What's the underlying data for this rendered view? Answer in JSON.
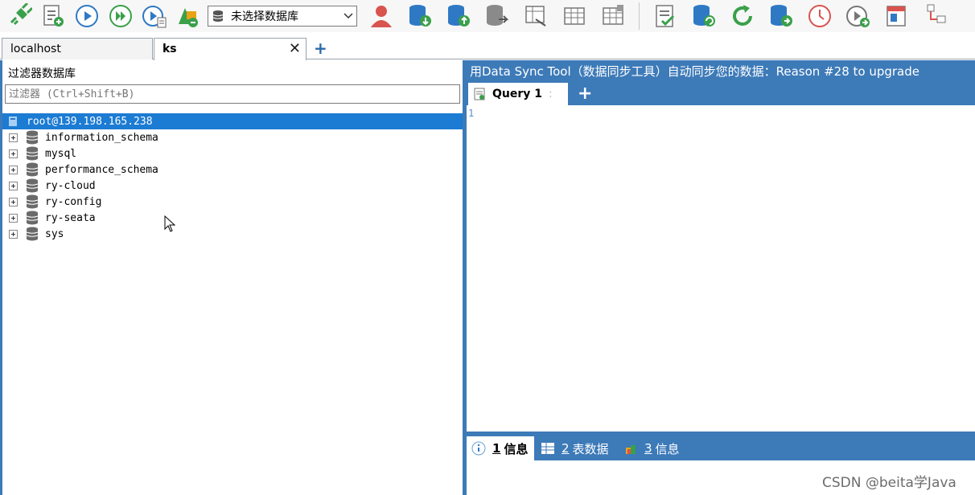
{
  "toolbar": {
    "icons": [
      "connect-icon",
      "new-query-icon",
      "run-icon",
      "run-all-icon",
      "run-file-icon",
      "schema-designer-icon",
      "user-icon",
      "backup-db-icon",
      "restore-db-icon",
      "export-db-icon",
      "import-icon",
      "table-icon",
      "table-data-icon",
      "sql-editor-icon",
      "sync-db-icon",
      "refresh-icon",
      "db-sync-icon",
      "schedule-icon",
      "run-task-icon",
      "window-icon",
      "more-icon"
    ],
    "db_select": {
      "value": "未选择数据库"
    }
  },
  "connection_tabs": [
    {
      "label": "localhost",
      "active": false
    },
    {
      "label": "ks",
      "active": true,
      "close": "✕"
    }
  ],
  "new_tab_label": "+",
  "left_panel": {
    "filter_title": "过滤器数据库",
    "filter_placeholder": "过滤器 (Ctrl+Shift+B)",
    "root": "root@139.198.165.238",
    "databases": [
      "information_schema",
      "mysql",
      "performance_schema",
      "ry-cloud",
      "ry-config",
      "ry-seata",
      "sys"
    ]
  },
  "right_panel": {
    "banner": "用Data Sync Tool（数据同步工具）自动同步您的数据：Reason #28 to upgrade",
    "query_tab": "Query 1",
    "query_tab_sep": ":",
    "add_query": "+",
    "line_number": "1",
    "bottom_tabs": [
      {
        "num": "1",
        "label": "信息",
        "active": true
      },
      {
        "num": "2",
        "label": "表数据",
        "active": false
      },
      {
        "num": "3",
        "label": "信息",
        "active": false
      }
    ]
  },
  "watermark": "CSDN @beita学Java",
  "colors": {
    "accent": "#3d7ab8",
    "selection": "#1c7bd3",
    "icon_green": "#3aa04a",
    "icon_blue": "#2f79c4"
  }
}
